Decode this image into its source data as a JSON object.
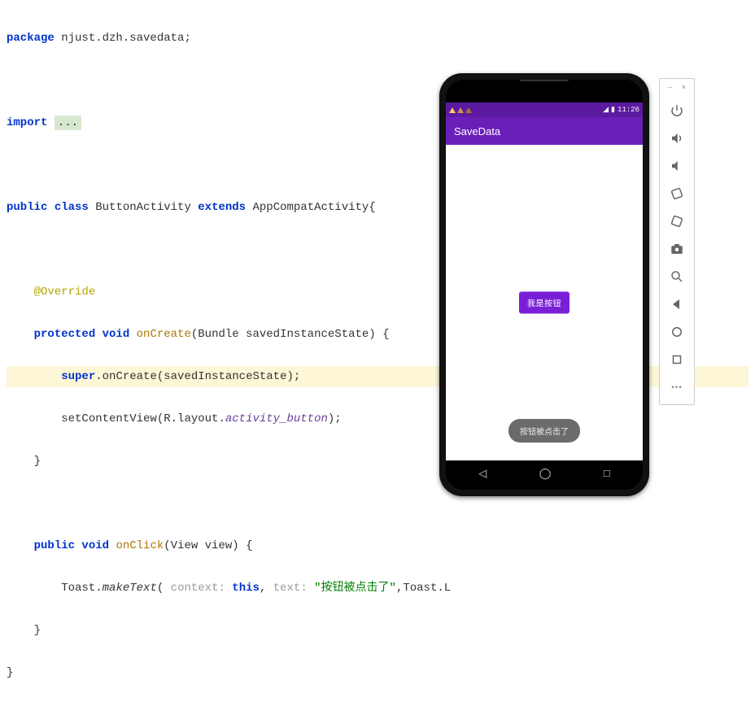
{
  "code": {
    "package_kw": "package",
    "package_name": " njust.dzh.savedata;",
    "import_kw": "import ",
    "import_ellipsis": "...",
    "public": "public ",
    "class_kw": "class ",
    "class_name": "ButtonActivity ",
    "extends_kw": "extends ",
    "super_class": "AppCompatActivity{",
    "override": "@Override",
    "protected": "protected ",
    "void": "void ",
    "onCreate": "onCreate",
    "onCreate_params": "(Bundle savedInstanceState) {",
    "super_kw": "super",
    "super_call": ".onCreate(savedInstanceState);",
    "setContentView": "setContentView(R.layout.",
    "layout_name": "activity_button",
    "close_paren": ");",
    "brace_close": "}",
    "onClick": "onClick",
    "onClick_params": "(View view) {",
    "toast_cls": "Toast.",
    "makeText": "makeText",
    "toast_open": "( ",
    "hint_context": "context: ",
    "this_kw": "this",
    "comma": ", ",
    "hint_text": "text: ",
    "toast_str": "\"按钮被点击了\"",
    "toast_tail": ",Toast.L"
  },
  "phone": {
    "status_time": "11:26",
    "app_title": "SaveData",
    "button_label": "我是按钮",
    "toast_label": "按钮被点击了"
  },
  "emu": {
    "minimize": "—",
    "close": "×"
  }
}
